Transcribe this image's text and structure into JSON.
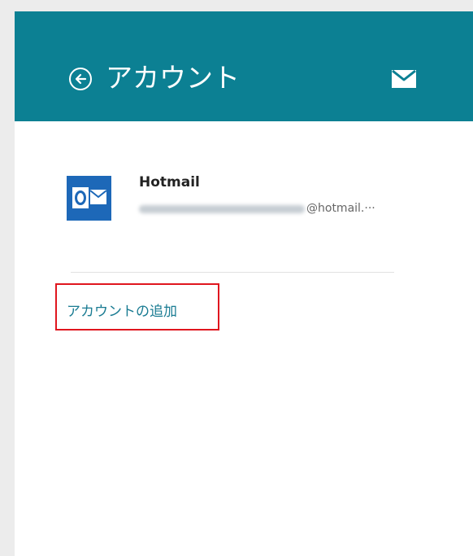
{
  "header": {
    "title": "アカウント",
    "back_icon": "back-arrow-circle-icon",
    "mail_icon": "mail-envelope-icon",
    "background_color": "#0c8093"
  },
  "accounts": [
    {
      "name": "Hotmail",
      "email_visible_suffix": "@hotmail.···",
      "icon": "outlook-icon",
      "icon_color": "#1d68b8"
    }
  ],
  "add_account": {
    "label": "アカウントの追加",
    "link_color": "#197b92",
    "highlight_color": "#e0161e"
  }
}
